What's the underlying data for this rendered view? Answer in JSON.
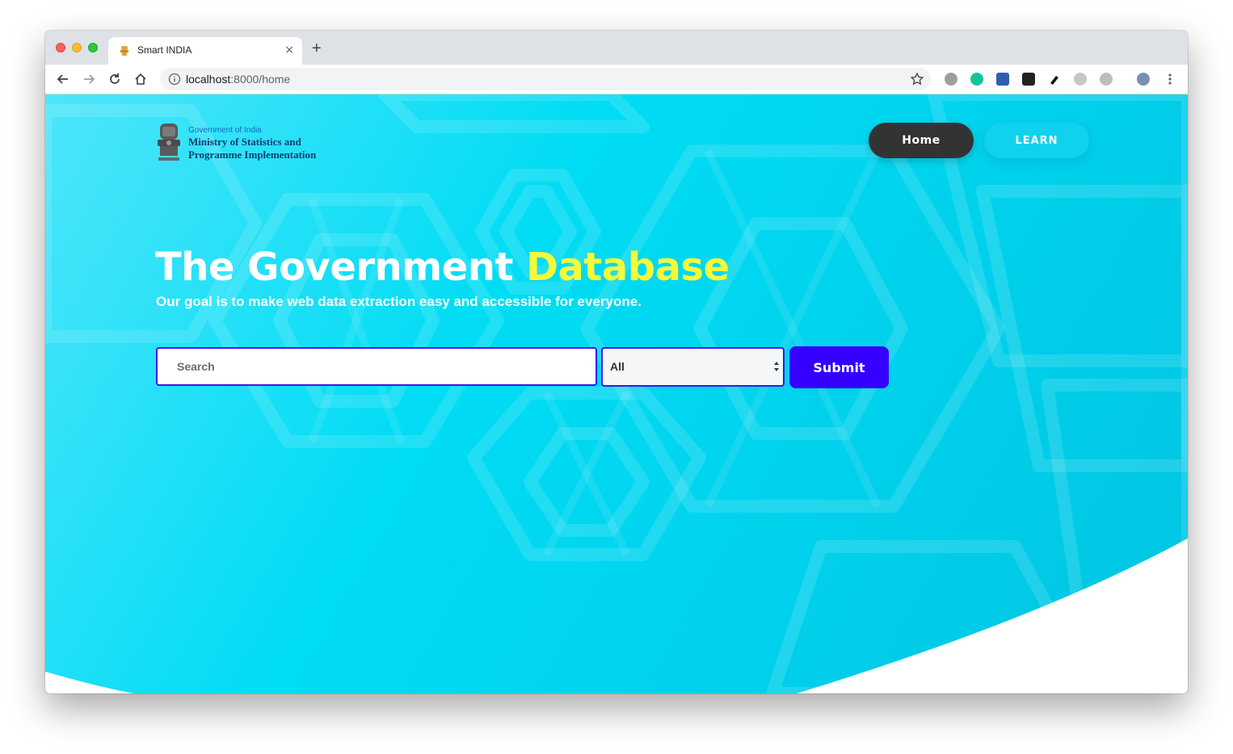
{
  "browser": {
    "tab_title": "Smart INDIA",
    "tab_close": "×",
    "new_tab": "+",
    "url_host": "localhost",
    "url_rest": ":8000/home"
  },
  "header": {
    "logo_line1": "Government of India",
    "logo_line2": "Ministry of Statistics and",
    "logo_line3": "Programme Implementation",
    "nav_home": "Home",
    "nav_learn": "LEARN"
  },
  "hero": {
    "title_main": "The Government ",
    "title_highlight": "Database",
    "subtitle": "Our goal is to make web data extraction easy and accessible for everyone."
  },
  "search": {
    "placeholder": "Search",
    "category_selected": "All",
    "submit_label": "Submit"
  },
  "colors": {
    "accent_blue": "#3500ff",
    "highlight_yellow": "#f5f93a",
    "nav_dark": "#333333"
  }
}
